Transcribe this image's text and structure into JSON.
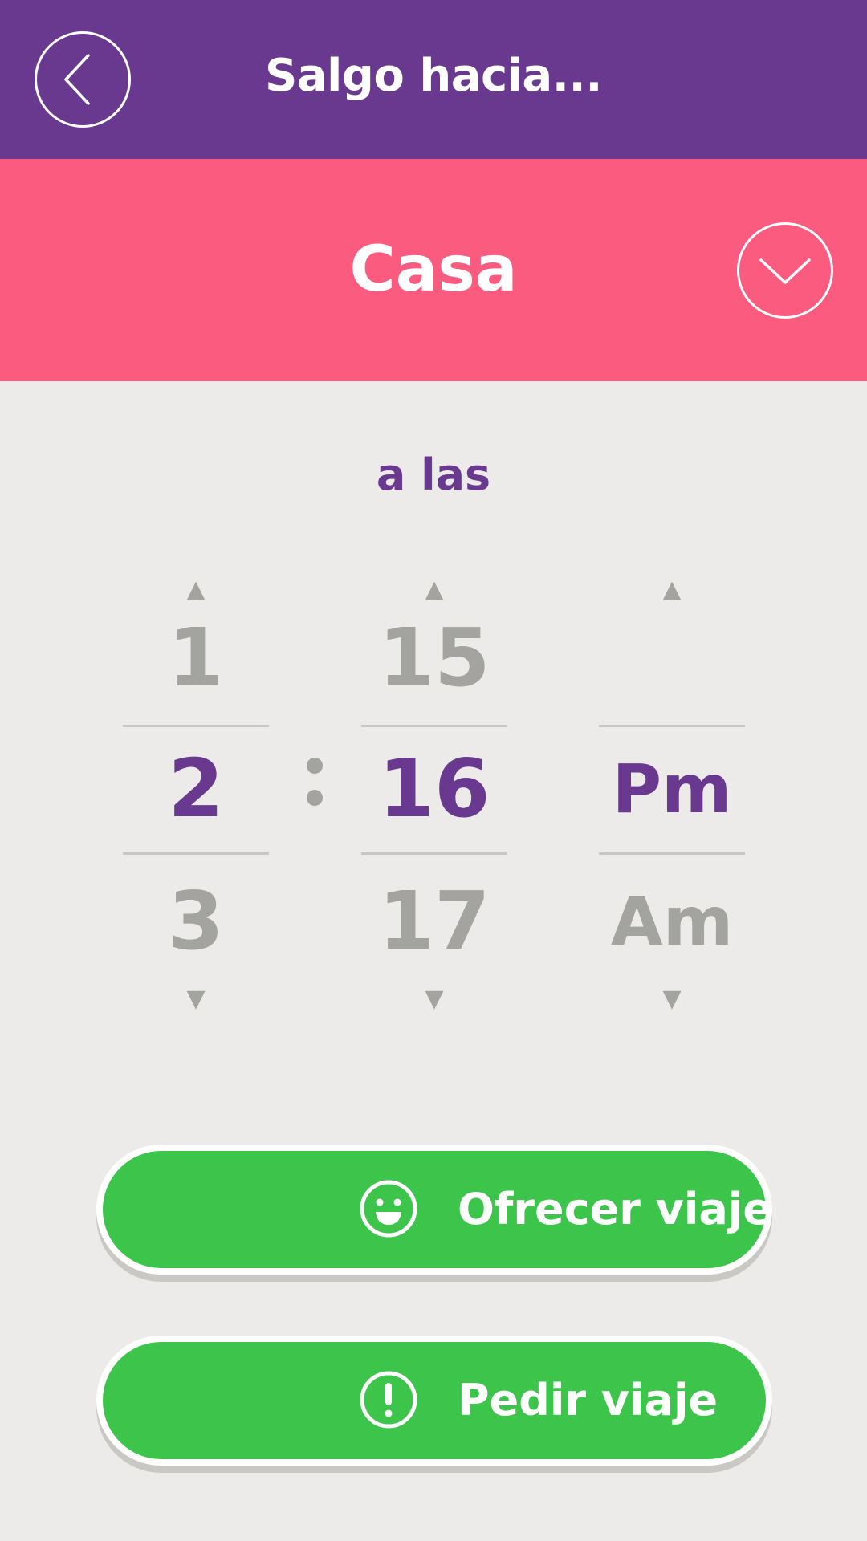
{
  "header": {
    "title": "Salgo hacia...",
    "back_icon": "chevron-left-icon"
  },
  "destination": {
    "label": "Casa",
    "dropdown_icon": "chevron-down-icon"
  },
  "time_prompt": "a las",
  "time_picker": {
    "hours": {
      "prev": "1",
      "current": "2",
      "next": "3"
    },
    "separator": ":",
    "minutes": {
      "prev": "15",
      "current": "16",
      "next": "17"
    },
    "period": {
      "prev": "",
      "current": "Pm",
      "next": "Am"
    }
  },
  "actions": {
    "offer": {
      "label": "Ofrecer viaje",
      "icon": "smiley-icon"
    },
    "request": {
      "label": "Pedir viaje",
      "icon": "exclamation-icon"
    }
  },
  "colors": {
    "header": "#69398f",
    "destination_bar": "#fa5b7e",
    "button": "#3dc44b",
    "accent_text": "#69398f",
    "muted_text": "#a3a3a0",
    "background": "#ecebe9"
  }
}
